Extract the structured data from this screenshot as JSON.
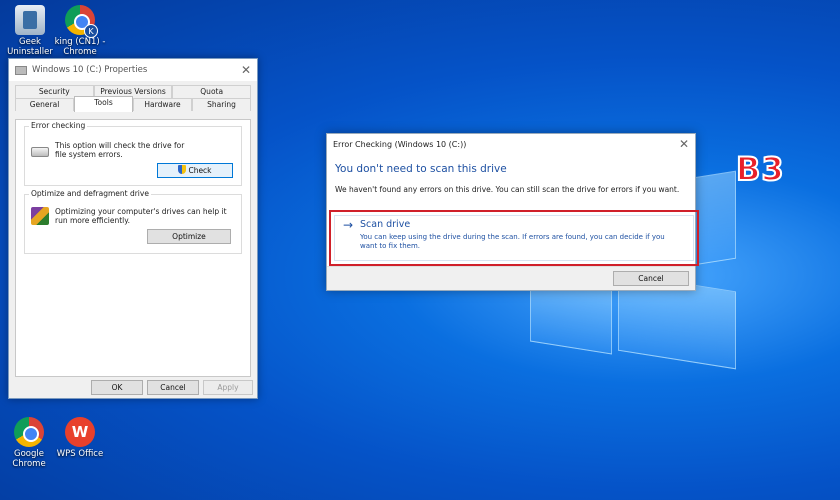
{
  "desktop": {
    "icons": [
      {
        "label_line1": "Geek",
        "label_line2": "Uninstaller",
        "icon": "geek-uninstaller-icon"
      },
      {
        "label_line1": "king (CN1) -",
        "label_line2": "Chrome",
        "icon": "chrome-profile-icon",
        "badge": "K"
      },
      {
        "label_line1": "Google",
        "label_line2": "Chrome",
        "icon": "chrome-icon"
      },
      {
        "label_line1": "WPS Office",
        "label_line2": "",
        "icon": "wps-office-icon",
        "glyph": "W"
      }
    ],
    "overlay_label": "B3",
    "overlay_color": "#e8202a"
  },
  "properties": {
    "title": "Windows 10 (C:) Properties",
    "tabs_row1": [
      "Security",
      "Previous Versions",
      "Quota"
    ],
    "tabs_row2": [
      "General",
      "Tools",
      "Hardware",
      "Sharing"
    ],
    "active_tab": "Tools",
    "error_checking": {
      "title": "Error checking",
      "text": "This option will check the drive for file system errors.",
      "button": "Check"
    },
    "optimize": {
      "title": "Optimize and defragment drive",
      "text": "Optimizing your computer's drives can help it run more efficiently.",
      "button": "Optimize"
    },
    "buttons": {
      "ok": "OK",
      "cancel": "Cancel",
      "apply": "Apply"
    }
  },
  "error_dialog": {
    "title": "Error Checking (Windows 10 (C:))",
    "heading": "You don't need to scan this drive",
    "message": "We haven't found any errors on this drive. You can still scan the drive for errors if you want.",
    "scan": {
      "arrow": "→",
      "title": "Scan drive",
      "description": "You can keep using the drive during the scan. If errors are found, you can decide if you want to fix them."
    },
    "cancel": "Cancel",
    "highlight_color": "#d0202a",
    "accent_color": "#1e50a2"
  }
}
